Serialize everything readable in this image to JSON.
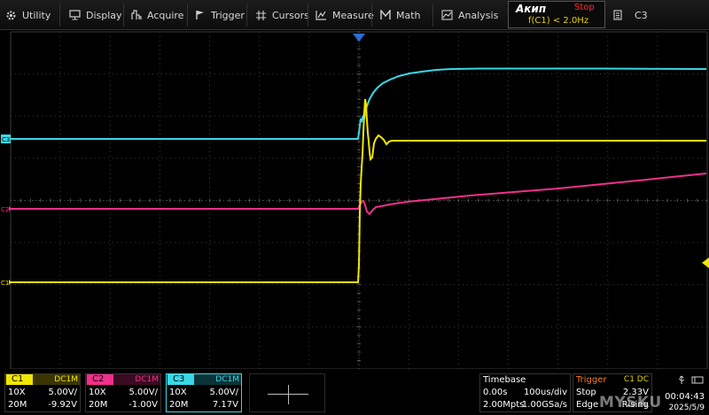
{
  "menu": {
    "utility": "Utility",
    "display": "Display",
    "acquire": "Acquire",
    "trigger": "Trigger",
    "cursors": "Cursors",
    "measure": "Measure",
    "math": "Math",
    "analysis": "Analysis"
  },
  "brand": "Акип",
  "run_state": "Stop",
  "trigger_freq": "f(C1) < 2.0Hz",
  "selected_channel": "C3",
  "markers": {
    "c3": "C3",
    "c2": "C2",
    "c1": "C1"
  },
  "channels": [
    {
      "name": "C1",
      "coupling": "DC1M",
      "probe": "10X",
      "scale": "5.00V/",
      "bw": "20M",
      "offset": "-9.92V",
      "color": "#f2e600"
    },
    {
      "name": "C2",
      "coupling": "DC1M",
      "probe": "10X",
      "scale": "5.00V/",
      "bw": "20M",
      "offset": "-1.00V",
      "color": "#f0308c"
    },
    {
      "name": "C3",
      "coupling": "DC1M",
      "probe": "10X",
      "scale": "5.00V/",
      "bw": "20M",
      "offset": "7.17V",
      "color": "#39d8e6"
    }
  ],
  "timebase": {
    "label": "Timebase",
    "delay": "0.00s",
    "scale": "100us/div",
    "memory": "2.00Mpts",
    "sample_rate": "1.00GSa/s"
  },
  "trigger": {
    "label": "Trigger",
    "source": "C1 DC",
    "state": "Stop",
    "level": "2.33V",
    "type": "Edge",
    "slope": "Rising"
  },
  "clock": {
    "time": "00:04:43",
    "date": "2025/5/9"
  },
  "watermark": "MYSKU",
  "colors": {
    "c1": "#f2e600",
    "c2": "#f0308c",
    "c3": "#39d8e6",
    "trigger_accent": "#ff7a1a",
    "stop": "#ff2a2a",
    "trigger_marker": "#2a6ed8"
  }
}
